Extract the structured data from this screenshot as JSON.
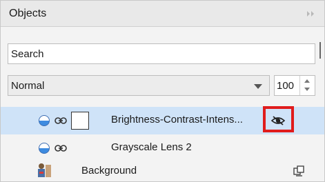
{
  "panel": {
    "title": "Objects",
    "collapse_icon": "double-chevron-right-icon"
  },
  "search": {
    "placeholder": "Search"
  },
  "blend_mode": {
    "value": "Normal"
  },
  "opacity": {
    "value": "100"
  },
  "objects": [
    {
      "name": "Brightness-Contrast-Intens...",
      "selected": true,
      "visibility_icon": "hidden-eye-icon"
    },
    {
      "name": "Grayscale Lens 2",
      "selected": false
    },
    {
      "name": "Background",
      "selected": false
    }
  ],
  "colors": {
    "selection": "#cfe3f8",
    "highlight": "#e01c1c"
  }
}
